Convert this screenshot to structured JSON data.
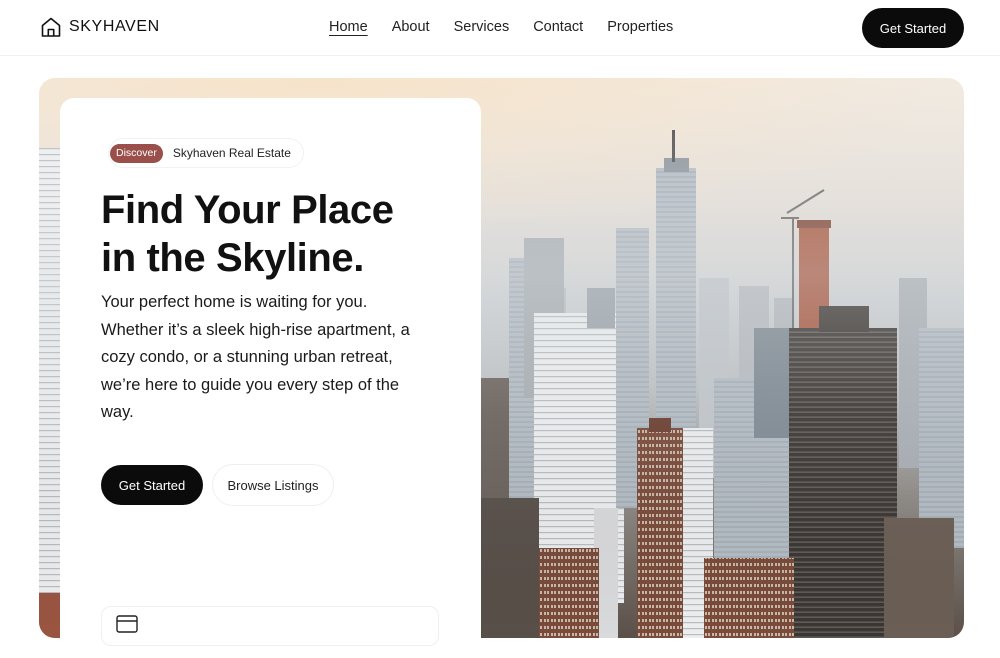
{
  "header": {
    "brand": "SKYHAVEN",
    "nav": [
      {
        "label": "Home",
        "active": true
      },
      {
        "label": "About"
      },
      {
        "label": "Services"
      },
      {
        "label": "Contact"
      },
      {
        "label": "Properties"
      }
    ],
    "cta_label": "Get Started"
  },
  "hero": {
    "badge": "Discover",
    "tagline": "Skyhaven Real Estate",
    "title_line1": "Find Your Place",
    "title_line2": "in the Skyline.",
    "description": "Your perfect home is waiting for you. Whether it’s a sleek high-rise apartment, a cozy condo, or a stunning urban retreat, we’re here to guide you every step of the way.",
    "primary_label": "Get Started",
    "secondary_label": "Browse Listings",
    "feature_text": "",
    "feature_icon": "building-icon",
    "image": "city-skyline-image"
  },
  "colors": {
    "accent": "#0b0b0b",
    "badge": "#9a4f4a",
    "background": "#ffffff"
  }
}
